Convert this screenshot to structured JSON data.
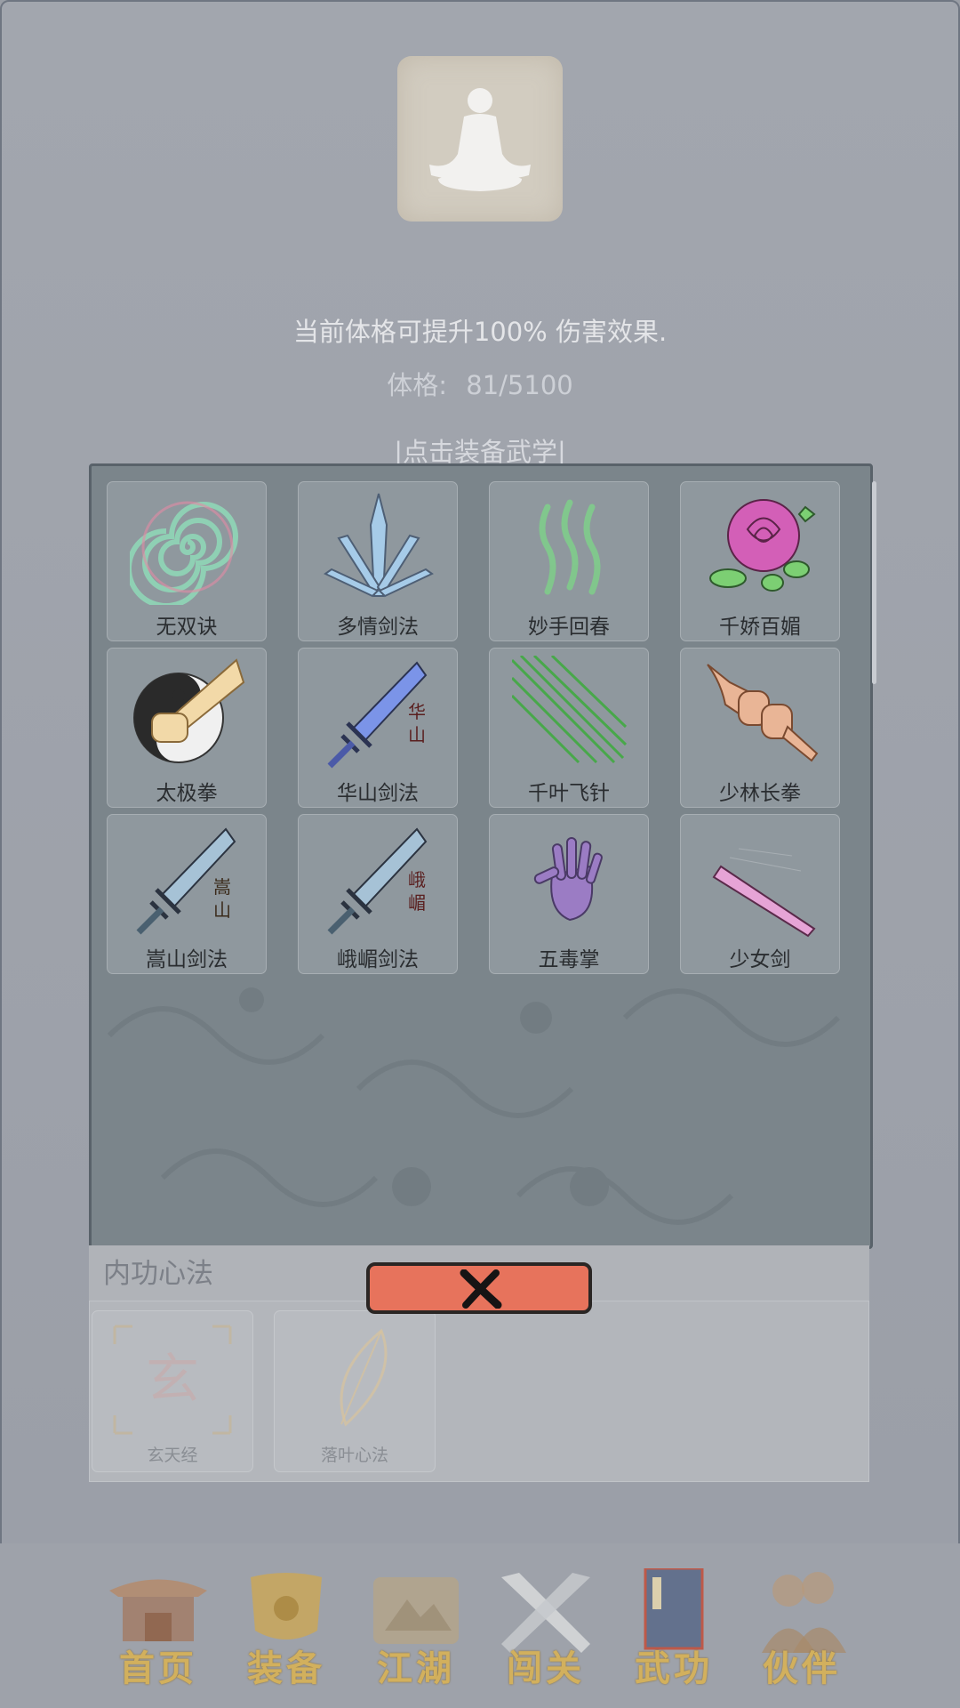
{
  "player": {
    "desc": "当前体格可提升100% 伤害效果.",
    "stat_label": "体格:",
    "stat_value": "81/5100",
    "equip_hint": "|点击装备武学|"
  },
  "martial_arts": [
    {
      "label": "无双诀",
      "icon": "spiral-icon"
    },
    {
      "label": "多情剑法",
      "icon": "crystal-blades-icon"
    },
    {
      "label": "妙手回春",
      "icon": "green-waves-icon"
    },
    {
      "label": "千娇百媚",
      "icon": "rose-icon"
    },
    {
      "label": "太极拳",
      "icon": "taiji-fist-icon"
    },
    {
      "label": "华山剑法",
      "icon": "sword-huashan-icon",
      "engraving": "华山"
    },
    {
      "label": "千叶飞针",
      "icon": "needles-icon"
    },
    {
      "label": "少林长拳",
      "icon": "fists-icon"
    },
    {
      "label": "嵩山剑法",
      "icon": "sword-songshan-icon",
      "engraving": "嵩山"
    },
    {
      "label": "峨嵋剑法",
      "icon": "sword-emei-icon",
      "engraving": "峨嵋"
    },
    {
      "label": "五毒掌",
      "icon": "purple-palm-icon"
    },
    {
      "label": "少女剑",
      "icon": "pink-sword-icon"
    }
  ],
  "inner": {
    "title": "内功心法",
    "items": [
      {
        "label": "玄天经",
        "icon": "xuantian-scroll-icon",
        "glyph": "玄"
      },
      {
        "label": "落叶心法",
        "icon": "leaf-icon"
      }
    ]
  },
  "close_icon": "close-icon",
  "nav": [
    {
      "label": "首页",
      "icon": "temple-icon"
    },
    {
      "label": "装备",
      "icon": "armor-icon"
    },
    {
      "label": "江湖",
      "icon": "map-scroll-icon"
    },
    {
      "label": "闯关",
      "icon": "crossed-swords-icon"
    },
    {
      "label": "武功",
      "icon": "book-icon"
    },
    {
      "label": "伙伴",
      "icon": "partners-icon"
    }
  ],
  "colors": {
    "background": "#9a9ea6",
    "panel": "#7b858b",
    "tile": "#8f989e",
    "close_button": "#e7735c",
    "nav_gold": "#d2b05d"
  }
}
